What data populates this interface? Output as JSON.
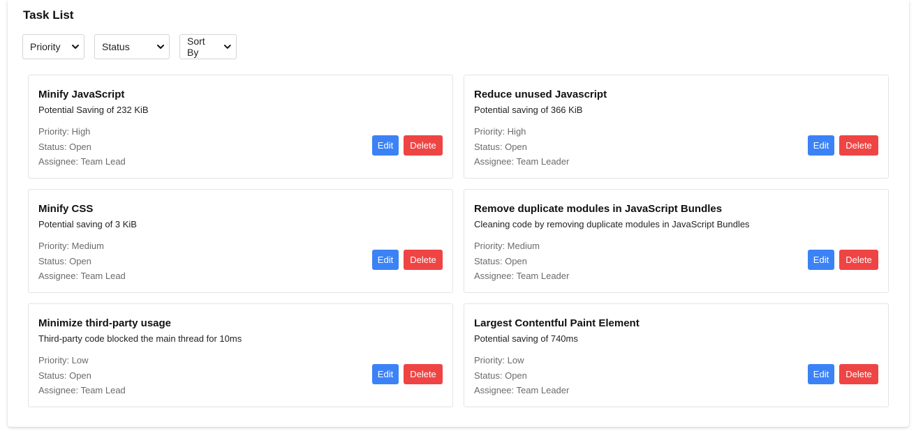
{
  "page": {
    "title": "Task List"
  },
  "filters": {
    "priority": "Priority",
    "status": "Status",
    "sort": "Sort By"
  },
  "labels": {
    "priority": "Priority: ",
    "status": "Status: ",
    "assignee": "Assignee: ",
    "edit": "Edit",
    "delete": "Delete"
  },
  "colors": {
    "edit_button": "#3b82f6",
    "delete_button": "#ef4444"
  },
  "icons": {
    "dropdown": "chevron-down-icon"
  },
  "tasks": [
    {
      "title": "Minify JavaScript",
      "description": "Potential Saving of 232 KiB",
      "priority": "High",
      "status": "Open",
      "assignee": "Team Lead"
    },
    {
      "title": "Reduce unused Javascript",
      "description": "Potential saving of 366 KiB",
      "priority": "High",
      "status": "Open",
      "assignee": "Team Leader"
    },
    {
      "title": "Minify CSS",
      "description": "Potential saving of 3 KiB",
      "priority": "Medium",
      "status": "Open",
      "assignee": "Team Lead"
    },
    {
      "title": "Remove duplicate modules in JavaScript Bundles",
      "description": "Cleaning code by removing duplicate modules in JavaScript Bundles",
      "priority": "Medium",
      "status": "Open",
      "assignee": "Team Leader"
    },
    {
      "title": "Minimize third-party usage",
      "description": "Third-party code blocked the main thread for 10ms",
      "priority": "Low",
      "status": "Open",
      "assignee": "Team Lead"
    },
    {
      "title": "Largest Contentful Paint Element",
      "description": "Potential saving of 740ms",
      "priority": "Low",
      "status": "Open",
      "assignee": "Team Leader"
    }
  ]
}
